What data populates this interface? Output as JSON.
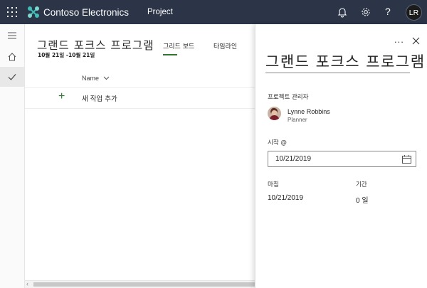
{
  "topbar": {
    "brand": "Contoso Electronics",
    "app": "Project",
    "help": "?",
    "avatar_initials": "LR"
  },
  "plan": {
    "title": "그랜드 포크스 프로그램",
    "dates": "10월 21일 -10월 21일",
    "tabs": [
      {
        "label": "그리드 보드",
        "active": true
      },
      {
        "label": "타임라인",
        "active": false
      }
    ],
    "column_name": "Name",
    "add_task_label": "새 작업 추가"
  },
  "panel": {
    "more": "...",
    "title": "그랜드 포크스 프로그램",
    "project_manager_label": "프로젝트 관리자",
    "manager": {
      "name": "Lynne Robbins",
      "role": "Planner"
    },
    "start_label": "시작 @",
    "start_value": "10/21/2019",
    "finish_label": "마침",
    "finish_value": "10/21/2019",
    "duration_label": "기간",
    "duration_value": "0 일"
  },
  "colors": {
    "topbar_bg": "#2b3547",
    "accent_green": "#31752f",
    "logo_teal": "#3dbfb8"
  },
  "icons": [
    "waffle-icon",
    "project-logo-icon",
    "bell-icon",
    "gear-icon",
    "help-icon",
    "hamburger-icon",
    "home-icon",
    "check-icon",
    "chevron-down-icon",
    "plus-icon",
    "more-icon",
    "close-icon",
    "calendar-icon"
  ]
}
